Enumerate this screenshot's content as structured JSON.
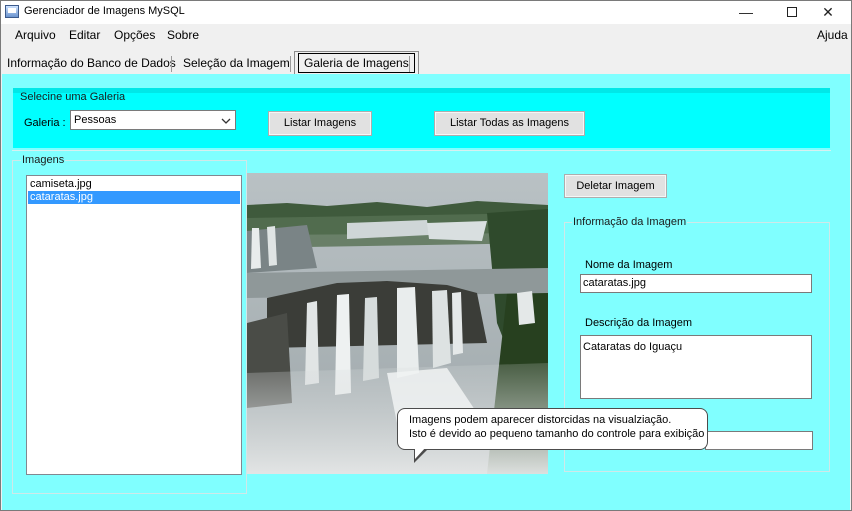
{
  "window": {
    "title": "Gerenciador de Imagens MySQL",
    "minimize_glyph": "—",
    "close_glyph": "✕"
  },
  "menu": {
    "arquivo": "Arquivo",
    "editar": "Editar",
    "opcoes": "Opções",
    "sobre": "Sobre",
    "ajuda": "Ajuda"
  },
  "tabs": [
    {
      "label": "Informação do Banco de Dados"
    },
    {
      "label": "Seleção da Imagem"
    },
    {
      "label": "Galeria de Imagens",
      "selected": true
    }
  ],
  "gallery": {
    "group_title": "Selecine uma Galeria",
    "label": "Galeria :",
    "selected_value": "Pessoas",
    "list_button": "Listar Imagens",
    "list_all_button": "Listar Todas as Imagens"
  },
  "images": {
    "group_title": "Imagens",
    "items": [
      "camiseta.jpg",
      "cataratas.jpg"
    ],
    "selected_index": 1
  },
  "actions": {
    "delete_button": "Deletar Imagem"
  },
  "info": {
    "group_title": "Informação da Imagem",
    "name_label": "Nome da Imagem",
    "name_value": "cataratas.jpg",
    "description_label": "Descrição da Imagem",
    "description_value": "Cataratas do Iguaçu"
  },
  "tooltip": {
    "line1": "Imagens podem aparecer distorcidas na visualziação.",
    "line2": "Isto é devido ao pequeno tamanho do controle para exibição"
  },
  "colors": {
    "content_background": "#80ffff",
    "gallery_panel": "#00ffff",
    "selection": "#3399ff"
  }
}
